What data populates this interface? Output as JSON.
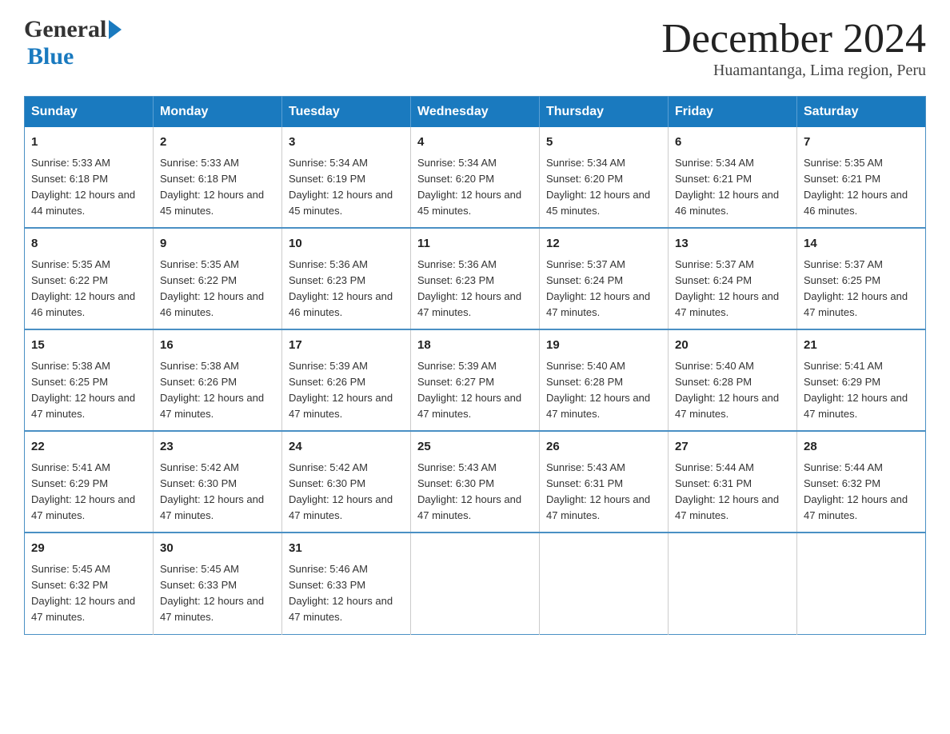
{
  "header": {
    "logo_general": "General",
    "logo_blue": "Blue",
    "title": "December 2024",
    "subtitle": "Huamantanga, Lima region, Peru"
  },
  "calendar": {
    "days_of_week": [
      "Sunday",
      "Monday",
      "Tuesday",
      "Wednesday",
      "Thursday",
      "Friday",
      "Saturday"
    ],
    "weeks": [
      [
        {
          "day": "1",
          "sunrise": "5:33 AM",
          "sunset": "6:18 PM",
          "daylight": "12 hours and 44 minutes."
        },
        {
          "day": "2",
          "sunrise": "5:33 AM",
          "sunset": "6:18 PM",
          "daylight": "12 hours and 45 minutes."
        },
        {
          "day": "3",
          "sunrise": "5:34 AM",
          "sunset": "6:19 PM",
          "daylight": "12 hours and 45 minutes."
        },
        {
          "day": "4",
          "sunrise": "5:34 AM",
          "sunset": "6:20 PM",
          "daylight": "12 hours and 45 minutes."
        },
        {
          "day": "5",
          "sunrise": "5:34 AM",
          "sunset": "6:20 PM",
          "daylight": "12 hours and 45 minutes."
        },
        {
          "day": "6",
          "sunrise": "5:34 AM",
          "sunset": "6:21 PM",
          "daylight": "12 hours and 46 minutes."
        },
        {
          "day": "7",
          "sunrise": "5:35 AM",
          "sunset": "6:21 PM",
          "daylight": "12 hours and 46 minutes."
        }
      ],
      [
        {
          "day": "8",
          "sunrise": "5:35 AM",
          "sunset": "6:22 PM",
          "daylight": "12 hours and 46 minutes."
        },
        {
          "day": "9",
          "sunrise": "5:35 AM",
          "sunset": "6:22 PM",
          "daylight": "12 hours and 46 minutes."
        },
        {
          "day": "10",
          "sunrise": "5:36 AM",
          "sunset": "6:23 PM",
          "daylight": "12 hours and 46 minutes."
        },
        {
          "day": "11",
          "sunrise": "5:36 AM",
          "sunset": "6:23 PM",
          "daylight": "12 hours and 47 minutes."
        },
        {
          "day": "12",
          "sunrise": "5:37 AM",
          "sunset": "6:24 PM",
          "daylight": "12 hours and 47 minutes."
        },
        {
          "day": "13",
          "sunrise": "5:37 AM",
          "sunset": "6:24 PM",
          "daylight": "12 hours and 47 minutes."
        },
        {
          "day": "14",
          "sunrise": "5:37 AM",
          "sunset": "6:25 PM",
          "daylight": "12 hours and 47 minutes."
        }
      ],
      [
        {
          "day": "15",
          "sunrise": "5:38 AM",
          "sunset": "6:25 PM",
          "daylight": "12 hours and 47 minutes."
        },
        {
          "day": "16",
          "sunrise": "5:38 AM",
          "sunset": "6:26 PM",
          "daylight": "12 hours and 47 minutes."
        },
        {
          "day": "17",
          "sunrise": "5:39 AM",
          "sunset": "6:26 PM",
          "daylight": "12 hours and 47 minutes."
        },
        {
          "day": "18",
          "sunrise": "5:39 AM",
          "sunset": "6:27 PM",
          "daylight": "12 hours and 47 minutes."
        },
        {
          "day": "19",
          "sunrise": "5:40 AM",
          "sunset": "6:28 PM",
          "daylight": "12 hours and 47 minutes."
        },
        {
          "day": "20",
          "sunrise": "5:40 AM",
          "sunset": "6:28 PM",
          "daylight": "12 hours and 47 minutes."
        },
        {
          "day": "21",
          "sunrise": "5:41 AM",
          "sunset": "6:29 PM",
          "daylight": "12 hours and 47 minutes."
        }
      ],
      [
        {
          "day": "22",
          "sunrise": "5:41 AM",
          "sunset": "6:29 PM",
          "daylight": "12 hours and 47 minutes."
        },
        {
          "day": "23",
          "sunrise": "5:42 AM",
          "sunset": "6:30 PM",
          "daylight": "12 hours and 47 minutes."
        },
        {
          "day": "24",
          "sunrise": "5:42 AM",
          "sunset": "6:30 PM",
          "daylight": "12 hours and 47 minutes."
        },
        {
          "day": "25",
          "sunrise": "5:43 AM",
          "sunset": "6:30 PM",
          "daylight": "12 hours and 47 minutes."
        },
        {
          "day": "26",
          "sunrise": "5:43 AM",
          "sunset": "6:31 PM",
          "daylight": "12 hours and 47 minutes."
        },
        {
          "day": "27",
          "sunrise": "5:44 AM",
          "sunset": "6:31 PM",
          "daylight": "12 hours and 47 minutes."
        },
        {
          "day": "28",
          "sunrise": "5:44 AM",
          "sunset": "6:32 PM",
          "daylight": "12 hours and 47 minutes."
        }
      ],
      [
        {
          "day": "29",
          "sunrise": "5:45 AM",
          "sunset": "6:32 PM",
          "daylight": "12 hours and 47 minutes."
        },
        {
          "day": "30",
          "sunrise": "5:45 AM",
          "sunset": "6:33 PM",
          "daylight": "12 hours and 47 minutes."
        },
        {
          "day": "31",
          "sunrise": "5:46 AM",
          "sunset": "6:33 PM",
          "daylight": "12 hours and 47 minutes."
        },
        null,
        null,
        null,
        null
      ]
    ]
  }
}
